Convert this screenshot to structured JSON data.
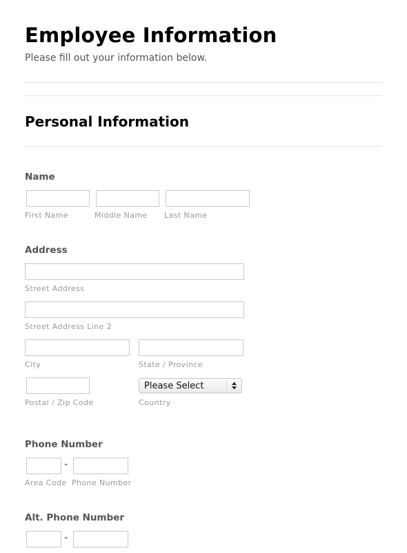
{
  "header": {
    "title": "Employee Information",
    "subtitle": "Please fill out your information below."
  },
  "section": {
    "title": "Personal Information"
  },
  "name": {
    "label": "Name",
    "first": {
      "value": "",
      "sublabel": "First Name"
    },
    "middle": {
      "value": "",
      "sublabel": "Middle Name"
    },
    "last": {
      "value": "",
      "sublabel": "Last Name"
    }
  },
  "address": {
    "label": "Address",
    "street": {
      "value": "",
      "sublabel": "Street Address"
    },
    "street2": {
      "value": "",
      "sublabel": "Street Address Line 2"
    },
    "city": {
      "value": "",
      "sublabel": "City"
    },
    "state": {
      "value": "",
      "sublabel": "State / Province"
    },
    "postal": {
      "value": "",
      "sublabel": "Postal / Zip Code"
    },
    "country": {
      "selected": "Please Select",
      "sublabel": "Country",
      "icon": "updown-arrows-icon"
    }
  },
  "phone": {
    "label": "Phone Number",
    "separator": "-",
    "area_code": {
      "value": "",
      "sublabel": "Area Code"
    },
    "number": {
      "value": "",
      "sublabel": "Phone Number"
    }
  },
  "alt_phone": {
    "label": "Alt. Phone Number",
    "separator": "-",
    "area_code": {
      "value": ""
    },
    "number": {
      "value": ""
    }
  }
}
